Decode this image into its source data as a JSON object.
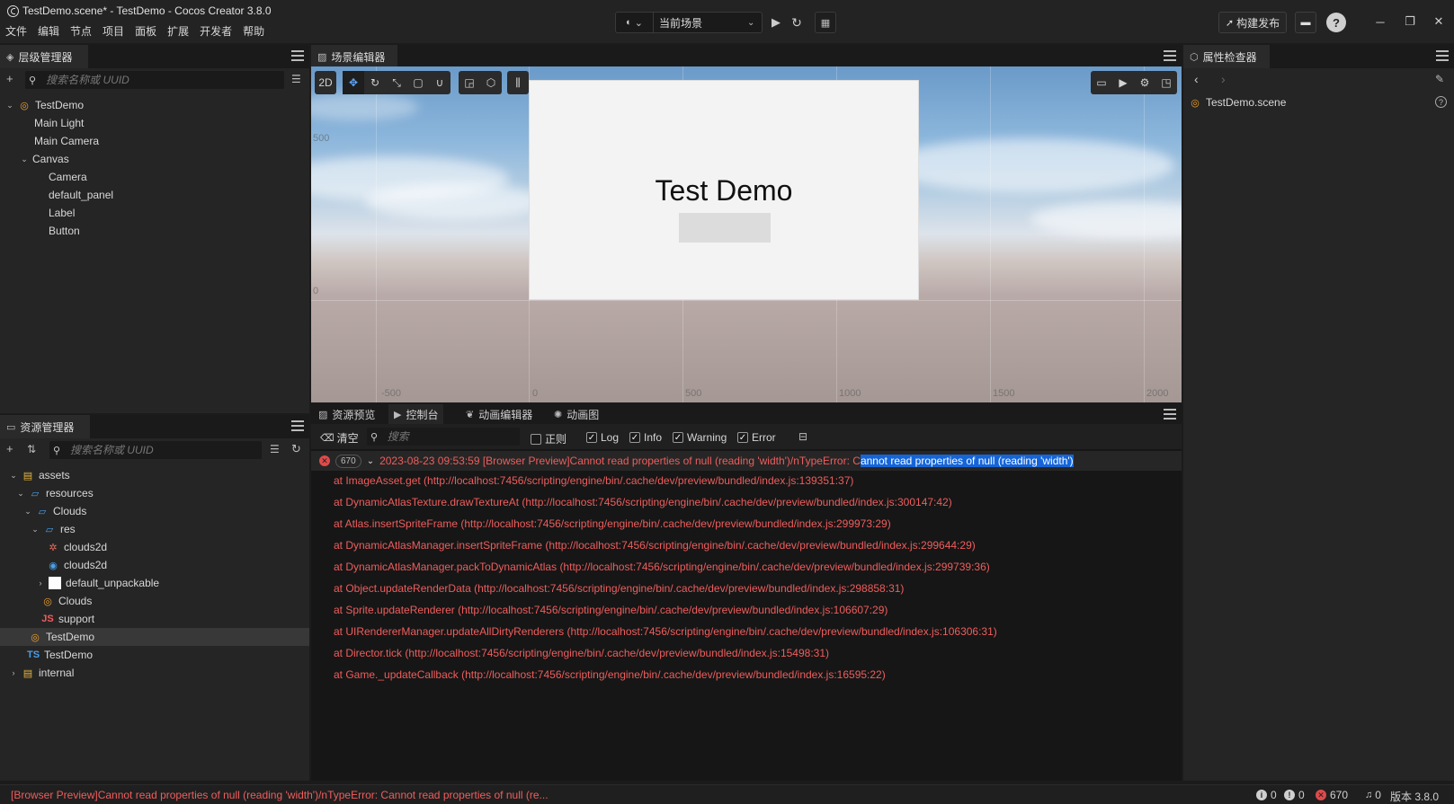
{
  "window": {
    "title": "TestDemo.scene* - TestDemo - Cocos Creator 3.8.0",
    "menu": [
      "文件",
      "编辑",
      "节点",
      "项目",
      "面板",
      "扩展",
      "开发者",
      "帮助"
    ]
  },
  "toolbar": {
    "scene_select": "当前场景",
    "build_label": "构建发布"
  },
  "hierarchy": {
    "tab": "层级管理器",
    "search_placeholder": "搜索名称或 UUID",
    "nodes": [
      "TestDemo",
      "Main Light",
      "Main Camera",
      "Canvas",
      "Camera",
      "default_panel",
      "Label",
      "Button"
    ]
  },
  "scene_editor": {
    "tab": "场景编辑器",
    "mode_2d": "2D",
    "canvas_label": "Test Demo",
    "axis_y": [
      "500",
      "0"
    ],
    "axis_x": [
      "-500",
      "0",
      "500",
      "1000",
      "1500",
      "2000"
    ]
  },
  "assets": {
    "tab": "资源管理器",
    "search_placeholder": "搜索名称或 UUID",
    "items": [
      "assets",
      "resources",
      "Clouds",
      "res",
      "clouds2d",
      "clouds2d",
      "default_unpackable",
      "Clouds",
      "support",
      "TestDemo",
      "TestDemo",
      "internal"
    ],
    "js_badge": "JS",
    "ts_badge": "TS"
  },
  "inspector": {
    "tab": "属性检查器",
    "item": "TestDemo.scene"
  },
  "console": {
    "tabs": [
      "资源预览",
      "控制台",
      "动画编辑器",
      "动画图"
    ],
    "clear": "清空",
    "search_placeholder": "搜索",
    "filters": [
      {
        "label": "正则",
        "checked": false
      },
      {
        "label": "Log",
        "checked": true
      },
      {
        "label": "Info",
        "checked": true
      },
      {
        "label": "Warning",
        "checked": true
      },
      {
        "label": "Error",
        "checked": true
      }
    ],
    "count": "670",
    "error_prefix": "2023-08-23 09:53:59 [Browser Preview]Cannot read properties of null (reading 'width')/nTypeError: C",
    "error_highlight": "annot read properties of null (reading 'width')",
    "stack": [
      "at ImageAsset.get (http://localhost:7456/scripting/engine/bin/.cache/dev/preview/bundled/index.js:139351:37)",
      "at DynamicAtlasTexture.drawTextureAt (http://localhost:7456/scripting/engine/bin/.cache/dev/preview/bundled/index.js:300147:42)",
      "at Atlas.insertSpriteFrame (http://localhost:7456/scripting/engine/bin/.cache/dev/preview/bundled/index.js:299973:29)",
      "at DynamicAtlasManager.insertSpriteFrame (http://localhost:7456/scripting/engine/bin/.cache/dev/preview/bundled/index.js:299644:29)",
      "at DynamicAtlasManager.packToDynamicAtlas (http://localhost:7456/scripting/engine/bin/.cache/dev/preview/bundled/index.js:299739:36)",
      "at Object.updateRenderData (http://localhost:7456/scripting/engine/bin/.cache/dev/preview/bundled/index.js:298858:31)",
      "at Sprite.updateRenderer (http://localhost:7456/scripting/engine/bin/.cache/dev/preview/bundled/index.js:106607:29)",
      "at UIRendererManager.updateAllDirtyRenderers (http://localhost:7456/scripting/engine/bin/.cache/dev/preview/bundled/index.js:106306:31)",
      "at Director.tick (http://localhost:7456/scripting/engine/bin/.cache/dev/preview/bundled/index.js:15498:31)",
      "at Game._updateCallback (http://localhost:7456/scripting/engine/bin/.cache/dev/preview/bundled/index.js:16595:22)"
    ]
  },
  "status": {
    "message": "[Browser Preview]Cannot read properties of null (reading 'width')/nTypeError: Cannot read properties of null (re...",
    "info_count": "0",
    "warn_count": "0",
    "error_count": "670",
    "notify_count": "0",
    "version": "版本 3.8.0"
  }
}
